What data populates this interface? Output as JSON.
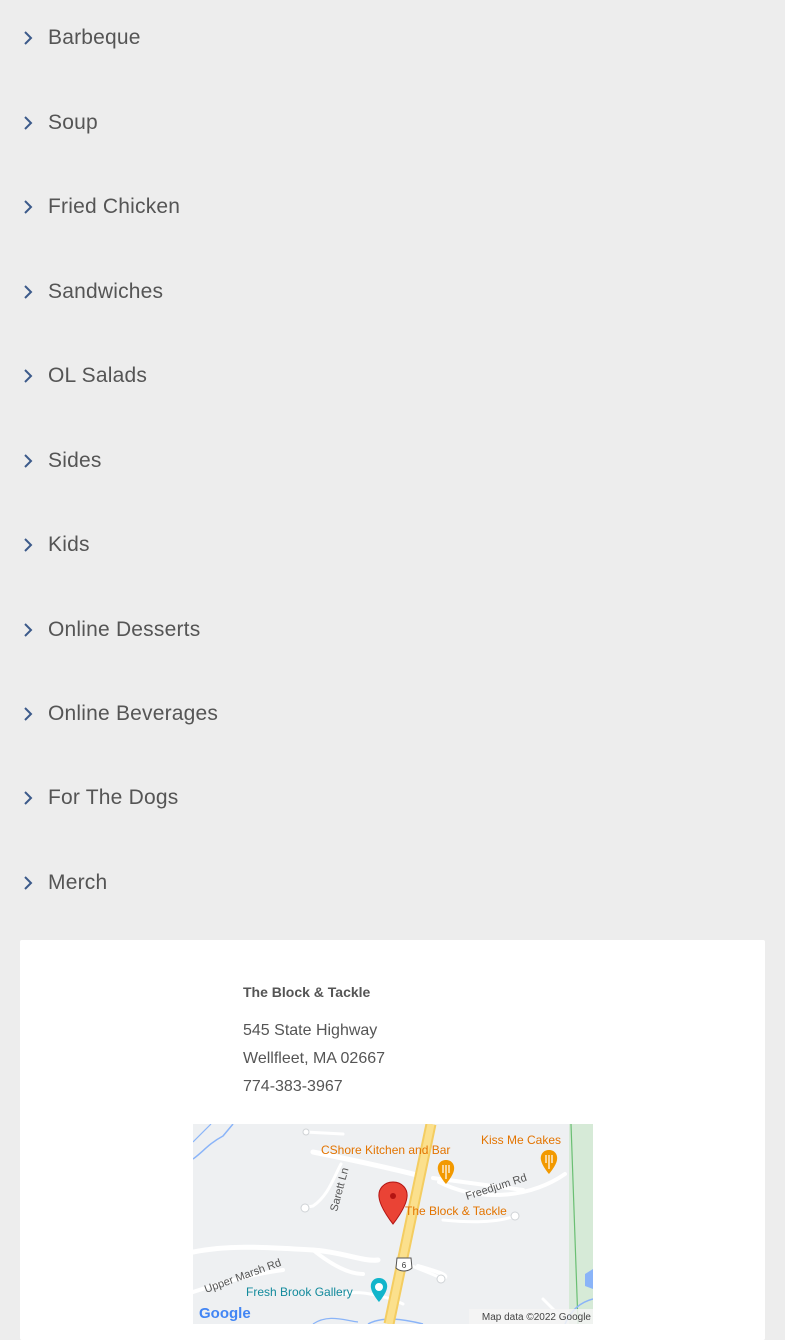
{
  "menu": {
    "items": [
      {
        "label": "Barbeque"
      },
      {
        "label": "Soup"
      },
      {
        "label": "Fried Chicken"
      },
      {
        "label": "Sandwiches"
      },
      {
        "label": "OL Salads"
      },
      {
        "label": "Sides"
      },
      {
        "label": "Kids"
      },
      {
        "label": "Online Desserts"
      },
      {
        "label": "Online Beverages"
      },
      {
        "label": "For The Dogs"
      },
      {
        "label": "Merch"
      }
    ]
  },
  "location": {
    "name": "The Block & Tackle",
    "street": "545 State Highway",
    "city_line": "Wellfleet, MA 02667",
    "phone": "774-383-3967"
  },
  "map": {
    "places": {
      "cshore": "CShore Kitchen and Bar",
      "kissme": "Kiss Me Cakes",
      "block": "The Block & Tackle",
      "freshbrook": "Fresh Brook Gallery"
    },
    "roads": {
      "sarett": "Sarett Ln",
      "freedjum": "Freedjum Rd",
      "uppermarsh": "Upper Marsh Rd",
      "route": "6"
    },
    "google_logo": "Google",
    "attribution": "Map data ©2022 Google"
  },
  "colors": {
    "page_bg": "#ededed",
    "text": "#555555",
    "chevron": "#3c5a8a",
    "card_bg": "#ffffff"
  }
}
